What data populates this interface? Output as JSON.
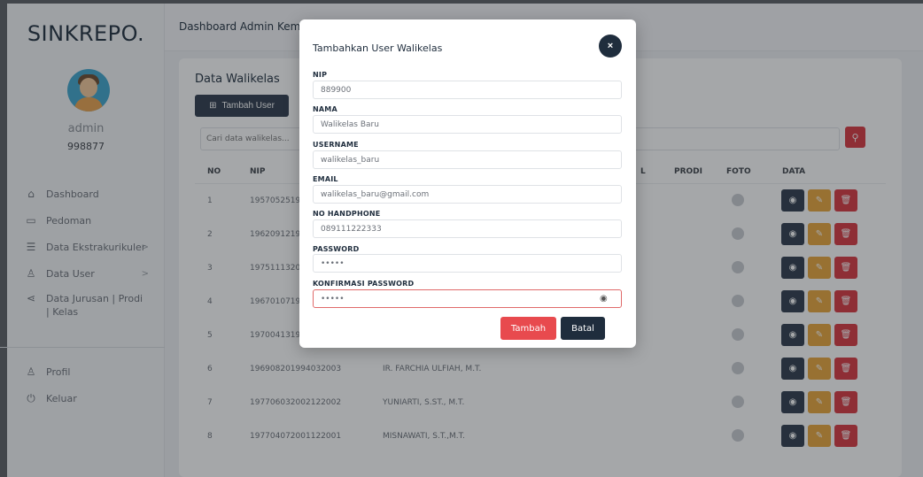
{
  "app": {
    "brand": "SINKREPO."
  },
  "sidebar": {
    "user": {
      "name": "admin",
      "id": "998877"
    },
    "items": [
      {
        "label": "Dashboard",
        "icon": "home-icon"
      },
      {
        "label": "Pedoman",
        "icon": "book-icon"
      },
      {
        "label": "Data Ekstrakurikuler",
        "icon": "list-icon",
        "chevron": ">"
      },
      {
        "label": "Data User",
        "icon": "user-icon",
        "chevron": ">"
      },
      {
        "label": "Data Jurusan | Prodi | Kelas",
        "icon": "share-icon"
      }
    ],
    "bottom_items": [
      {
        "label": "Profil",
        "icon": "user-icon"
      },
      {
        "label": "Keluar",
        "icon": "power-icon"
      }
    ]
  },
  "header": {
    "title": "Dashboard Admin Kema"
  },
  "main": {
    "card_title": "Data Walikelas",
    "add_button": "Tambah User",
    "search_placeholder": "Cari data walikelas...",
    "columns": {
      "no": "NO",
      "nip": "NIP",
      "l": "L",
      "prodi": "PRODI",
      "foto": "FOTO",
      "data": "DATA"
    },
    "rows": [
      {
        "no": "1",
        "nip": "1957052519",
        "nama": ""
      },
      {
        "no": "2",
        "nip": "1962091219",
        "nama": ""
      },
      {
        "no": "3",
        "nip": "1975111320",
        "nama": ""
      },
      {
        "no": "4",
        "nip": "1967010719",
        "nama": ""
      },
      {
        "no": "5",
        "nip": "1970041319",
        "nama": ""
      },
      {
        "no": "6",
        "nip": "196908201994032003",
        "nama": "IR. FARCHIA ULFIAH, M.T."
      },
      {
        "no": "7",
        "nip": "197706032002122002",
        "nama": "YUNIARTI, S.ST., M.T."
      },
      {
        "no": "8",
        "nip": "197704072001122001",
        "nama": "MISNAWATI, S.T.,M.T."
      }
    ]
  },
  "modal": {
    "title": "Tambahkan User Walikelas",
    "close_label": "×",
    "fields": {
      "nip": {
        "label": "NIP",
        "value": "889900"
      },
      "nama": {
        "label": "NAMA",
        "value": "Walikelas Baru"
      },
      "username": {
        "label": "USERNAME",
        "value": "walikelas_baru"
      },
      "email": {
        "label": "EMAIL",
        "value": "walikelas_baru@gmail.com"
      },
      "phone": {
        "label": "NO HANDPHONE",
        "value": "089111222333"
      },
      "password": {
        "label": "PASSWORD",
        "value": "•••••"
      },
      "confirm": {
        "label": "KONFIRMASI PASSWORD",
        "value": "•••••"
      }
    },
    "submit_label": "Tambah",
    "cancel_label": "Batal"
  },
  "colors": {
    "primary_dark": "#2d3a4b",
    "danger": "#e84a4e",
    "warning": "#e9a53a"
  }
}
